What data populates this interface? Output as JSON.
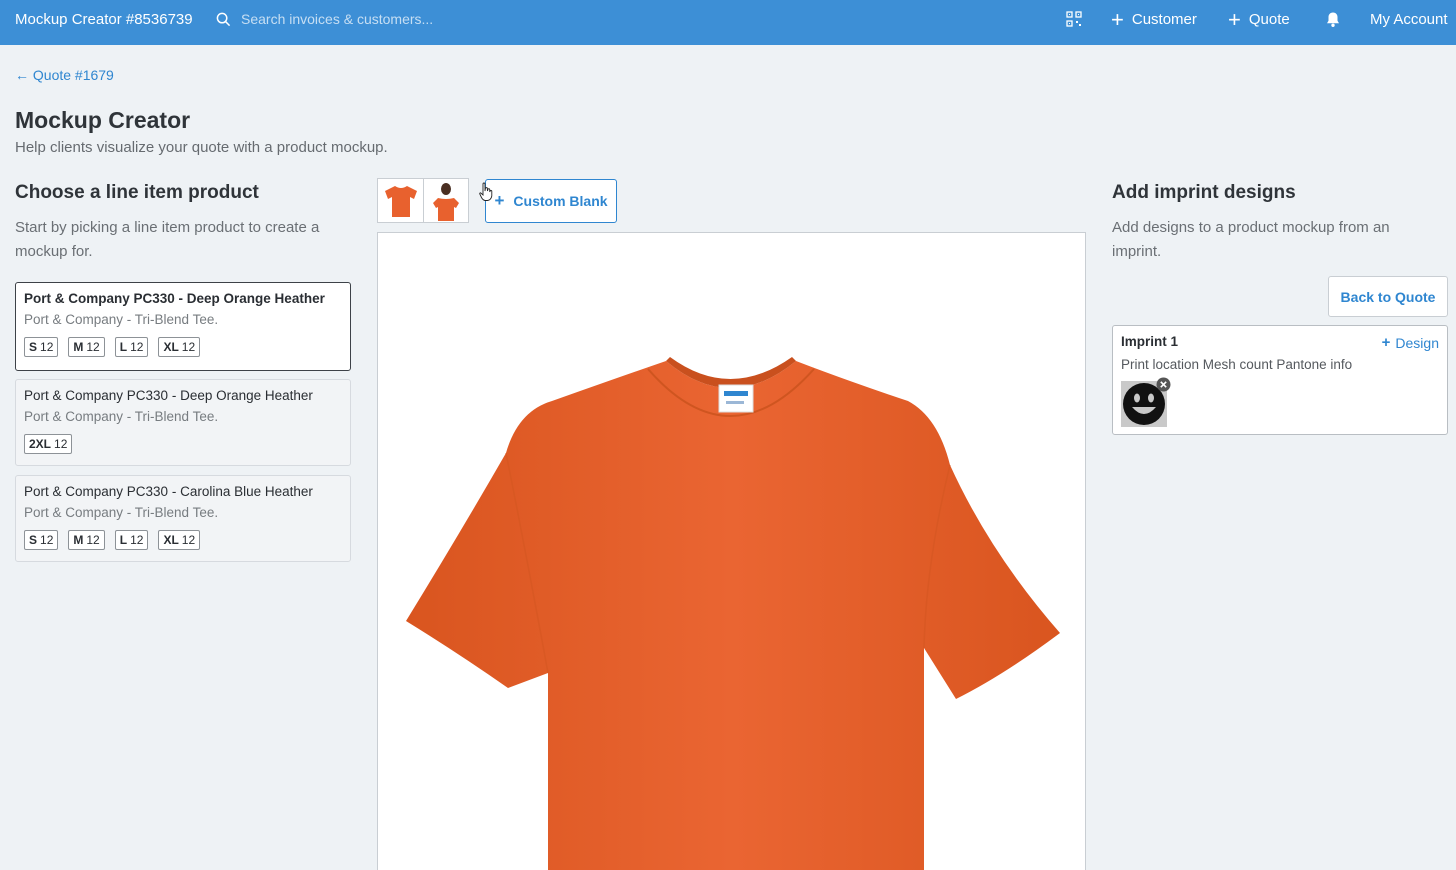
{
  "topbar": {
    "title": "Mockup Creator #8536739",
    "search_placeholder": "Search invoices & customers...",
    "customer_label": "Customer",
    "quote_label": "Quote",
    "account_label": "My Account"
  },
  "back_link": "← Quote #1679",
  "page": {
    "title": "Mockup Creator",
    "subtitle": "Help clients visualize your quote with a product mockup."
  },
  "left": {
    "heading": "Choose a line item product",
    "description": "Start by picking a line item product to create a mockup for.",
    "products": [
      {
        "name": "Port & Company PC330 - Deep Orange Heather",
        "description": "Port & Company - Tri-Blend Tee.",
        "sizes": [
          {
            "size": "S",
            "qty": "12"
          },
          {
            "size": "M",
            "qty": "12"
          },
          {
            "size": "L",
            "qty": "12"
          },
          {
            "size": "XL",
            "qty": "12"
          }
        ]
      },
      {
        "name": "Port & Company PC330 - Deep Orange Heather",
        "description": "Port & Company - Tri-Blend Tee.",
        "sizes": [
          {
            "size": "2XL",
            "qty": "12"
          }
        ]
      },
      {
        "name": "Port & Company PC330 - Carolina Blue Heather",
        "description": "Port & Company - Tri-Blend Tee.",
        "sizes": [
          {
            "size": "S",
            "qty": "12"
          },
          {
            "size": "M",
            "qty": "12"
          },
          {
            "size": "L",
            "qty": "12"
          },
          {
            "size": "XL",
            "qty": "12"
          }
        ]
      }
    ]
  },
  "center": {
    "custom_blank_label": "Custom Blank",
    "shirt_color": "#e8612e"
  },
  "right": {
    "heading": "Add imprint designs",
    "description": "Add designs to a product mockup from an imprint.",
    "back_button": "Back to Quote",
    "imprint": {
      "title": "Imprint 1",
      "add_design_label": "Design",
      "info": "Print location Mesh count Pantone info"
    }
  },
  "colors": {
    "topbar": "#3d8fd6",
    "link": "#2f86d0",
    "shirt": "#e8612e"
  }
}
